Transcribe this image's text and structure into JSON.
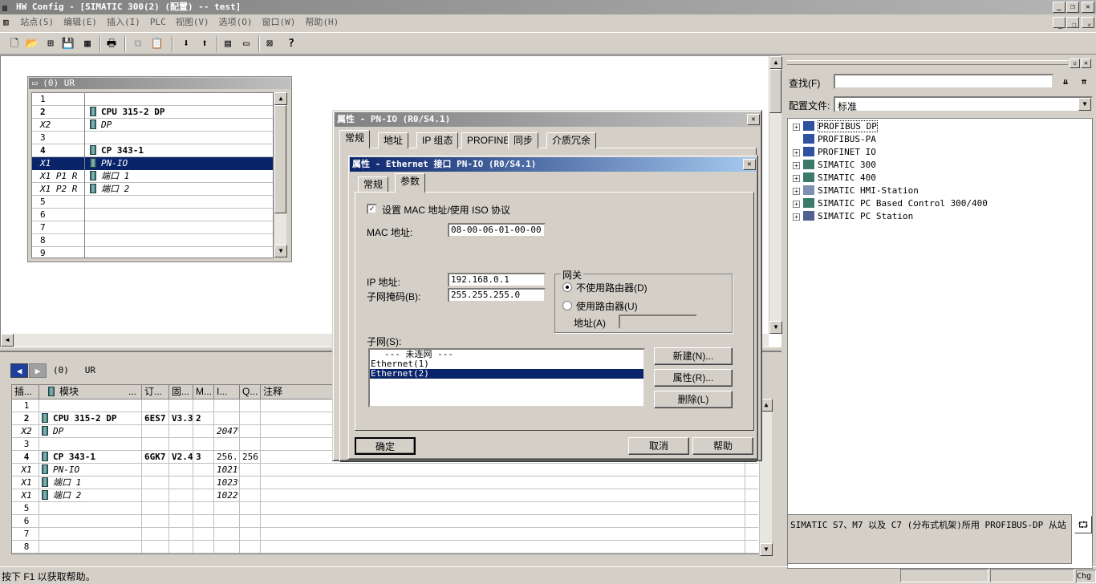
{
  "window": {
    "title": "HW Config - [SIMATIC 300(2) (配置) -- test]"
  },
  "menu": [
    "站点(S)",
    "编辑(E)",
    "插入(I)",
    "PLC",
    "视图(V)",
    "选项(O)",
    "窗口(W)",
    "帮助(H)"
  ],
  "rack": {
    "title": "(0) UR",
    "rows": [
      {
        "slot": "1",
        "module": "",
        "style": "normal"
      },
      {
        "slot": "2",
        "module": "CPU 315-2 DP",
        "style": "bold"
      },
      {
        "slot": "X2",
        "module": "DP",
        "style": "italic"
      },
      {
        "slot": "3",
        "module": "",
        "style": "normal"
      },
      {
        "slot": "4",
        "module": "CP 343-1",
        "style": "bold"
      },
      {
        "slot": "X1",
        "module": "PN-IO",
        "style": "selected"
      },
      {
        "slot": "X1 P1 R",
        "module": "端口 1",
        "style": "italic"
      },
      {
        "slot": "X1 P2 R",
        "module": "端口 2",
        "style": "italic"
      },
      {
        "slot": "5",
        "module": "",
        "style": "normal"
      },
      {
        "slot": "6",
        "module": "",
        "style": "normal"
      },
      {
        "slot": "7",
        "module": "",
        "style": "normal"
      },
      {
        "slot": "8",
        "module": "",
        "style": "normal"
      },
      {
        "slot": "9",
        "module": "",
        "style": "normal"
      }
    ]
  },
  "detail": {
    "nav_label": "(0)   UR",
    "headers": [
      "插...",
      "模块",
      "订...",
      "固...",
      "M...",
      "I...",
      "Q...",
      "注释"
    ],
    "module_header_dots": "...",
    "rows": [
      [
        "1",
        "",
        "",
        "",
        "",
        "",
        "",
        ""
      ],
      [
        "2",
        "CPU 315-2 DP",
        "6ES7",
        "V3.3",
        "2",
        "",
        "",
        ""
      ],
      [
        "X2",
        "DP",
        "",
        "",
        "",
        "2047*",
        "",
        ""
      ],
      [
        "3",
        "",
        "",
        "",
        "",
        "",
        "",
        ""
      ],
      [
        "4",
        "CP 343-1",
        "6GK7",
        "V2.4",
        "3",
        "256.",
        "256.",
        ""
      ],
      [
        "X1",
        "PN-IO",
        "",
        "",
        "",
        "1021*",
        "",
        ""
      ],
      [
        "X1",
        "端口 1",
        "",
        "",
        "",
        "1023*",
        "",
        ""
      ],
      [
        "X1",
        "端口 2",
        "",
        "",
        "",
        "1022*",
        "",
        ""
      ],
      [
        "5",
        "",
        "",
        "",
        "",
        "",
        "",
        ""
      ],
      [
        "6",
        "",
        "",
        "",
        "",
        "",
        "",
        ""
      ],
      [
        "7",
        "",
        "",
        "",
        "",
        "",
        "",
        ""
      ],
      [
        "8",
        "",
        "",
        "",
        "",
        "",
        "",
        ""
      ]
    ]
  },
  "dialog1": {
    "title": "属性 - PN-IO (R0/S4.1)",
    "tabs": [
      "常规",
      "地址",
      "IP 组态",
      "PROFINET",
      "同步",
      "介质冗余"
    ]
  },
  "dialog2": {
    "title": "属性 - Ethernet 接口  PN-IO (R0/S4.1)",
    "tabs": [
      "常规",
      "参数"
    ],
    "mac_checkbox": "设置 MAC 地址/使用 ISO 协议",
    "mac_label": "MAC 地址:",
    "mac_value": "08-00-06-01-00-00",
    "ip_label": "IP 地址:",
    "ip_value": "192.168.0.1",
    "mask_label": "子网掩码(B):",
    "mask_value": "255.255.255.0",
    "gateway_label": "网关",
    "radio_no_router": "不使用路由器(D)",
    "radio_router": "使用路由器(U)",
    "addr_label": "地址(A)",
    "subnet_label": "子网(S):",
    "subnets": [
      "--- 未连网 ---",
      "Ethernet(1)",
      "Ethernet(2)"
    ],
    "btn_new": "新建(N)...",
    "btn_props": "属性(R)...",
    "btn_delete": "删除(L)",
    "btn_ok": "确定",
    "btn_cancel": "取消",
    "btn_help": "帮助"
  },
  "catalog": {
    "find_label": "查找(F)",
    "profile_label": "配置文件:",
    "profile_value": "标准",
    "tree": [
      "PROFIBUS DP",
      "PROFIBUS-PA",
      "PROFINET IO",
      "SIMATIC 300",
      "SIMATIC 400",
      "SIMATIC HMI-Station",
      "SIMATIC PC Based Control 300/400",
      "SIMATIC PC Station"
    ],
    "description": "SIMATIC S7、M7 以及 C7 (分布式机架)所用 PROFIBUS-DP 从站"
  },
  "status": {
    "text": "按下 F1 以获取帮助。",
    "right": "Chg"
  }
}
